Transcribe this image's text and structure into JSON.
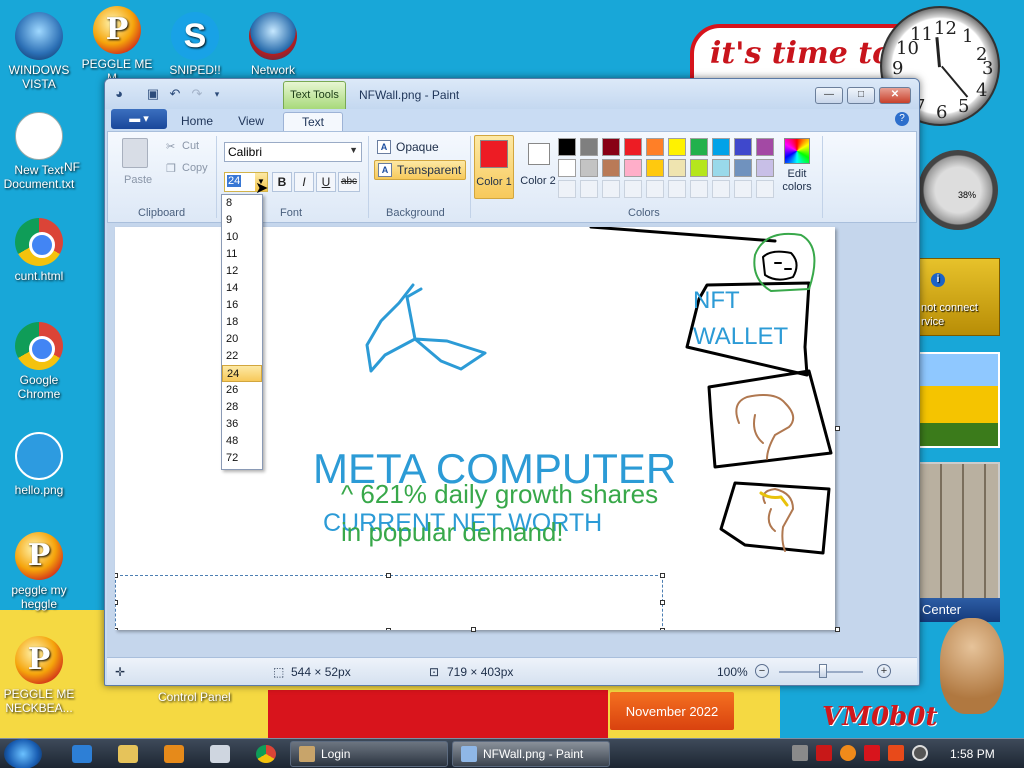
{
  "desktop": {
    "icons": [
      {
        "label": "WINDOWS VISTA",
        "icon": "vista-orb-icon"
      },
      {
        "label": "PEGGLE ME M...",
        "icon": "peggle-icon"
      },
      {
        "label": "SNIPED!! EPIC",
        "icon": "skype-icon"
      },
      {
        "label": "Network",
        "icon": "network-icon"
      },
      {
        "label": "New Text Document.txt",
        "icon": "text-file-icon"
      },
      {
        "label": "NF",
        "icon": "file-icon"
      },
      {
        "label": "cunt.html",
        "icon": "chrome-icon"
      },
      {
        "label": "Google Chrome",
        "icon": "chrome-icon"
      },
      {
        "label": "hello.png",
        "icon": "image-file-icon"
      },
      {
        "label": "peggle my heggle",
        "icon": "peggle-icon"
      },
      {
        "label": "PEGGLE ME NECKBEA...",
        "icon": "peggle-icon"
      },
      {
        "label": "Control Panel",
        "icon": "control-panel-icon"
      }
    ],
    "wallpaper_text": "it's time to e",
    "watermark": "VM0b0t",
    "calendar_text": "November 2022",
    "gadget_map_text": "not connect\nrvice",
    "gadget_meter_text": "38%",
    "gadget_center_text": "Center",
    "clock": {
      "numbers": [
        "12",
        "1",
        "2",
        "3",
        "4",
        "5",
        "6",
        "7",
        "8",
        "9",
        "10",
        "11"
      ]
    }
  },
  "window": {
    "title": "NFWall.png - Paint",
    "contextual_tab": "Text Tools",
    "tabs": [
      {
        "label": "Home",
        "active": false
      },
      {
        "label": "View",
        "active": false
      },
      {
        "label": "Text",
        "active": true
      }
    ],
    "controls": {
      "minimize": "—",
      "maximize": "□",
      "close": "✕"
    },
    "help": "?"
  },
  "ribbon": {
    "clipboard": {
      "label": "Clipboard",
      "paste": "Paste",
      "cut": "Cut",
      "copy": "Copy"
    },
    "font": {
      "label": "Font",
      "family": "Calibri",
      "size": "24",
      "bold": "B",
      "italic": "I",
      "underline": "U",
      "strike": "abc",
      "size_options": [
        "8",
        "9",
        "10",
        "11",
        "12",
        "14",
        "16",
        "18",
        "20",
        "22",
        "24",
        "26",
        "28",
        "36",
        "48",
        "72"
      ],
      "highlighted_size": "24"
    },
    "background": {
      "label": "Background",
      "opaque": "Opaque",
      "transparent": "Transparent",
      "selected": "Transparent"
    },
    "colors": {
      "label": "Colors",
      "color1_label": "Color 1",
      "color1_value": "#ED1C24",
      "color2_label": "Color 2",
      "color2_value": "#FFFFFF",
      "edit_colors": "Edit colors",
      "palette": [
        "#000000",
        "#7F7F7F",
        "#880015",
        "#ED1C24",
        "#FF7F27",
        "#FFF200",
        "#22B14C",
        "#00A2E8",
        "#3F48CC",
        "#A349A4",
        "#FFFFFF",
        "#C3C3C3",
        "#B97A57",
        "#FFAEC9",
        "#FFC90E",
        "#EFE4B0",
        "#B5E61D",
        "#99D9EA",
        "#7092BE",
        "#C8BFE7"
      ]
    }
  },
  "canvas": {
    "texts": {
      "nft_line1": "NFT",
      "nft_line2": "WALLET",
      "meta": "META COMPUTER",
      "growth": "^ 621% daily growth shares",
      "net_worth": "CURRENT NET WORTH",
      "demand": "in popular demand!"
    },
    "colors": {
      "blue": "#2C9BD6",
      "green": "#38A84A"
    }
  },
  "status": {
    "selection_size": "544 × 52px",
    "image_size": "719 × 403px",
    "zoom": "100%",
    "zoom_level": 1.0
  },
  "taskbar": {
    "tasks": [
      {
        "label": "Login",
        "active": false
      },
      {
        "label": "NFWall.png - Paint",
        "active": true
      }
    ],
    "time": "1:58 PM"
  }
}
